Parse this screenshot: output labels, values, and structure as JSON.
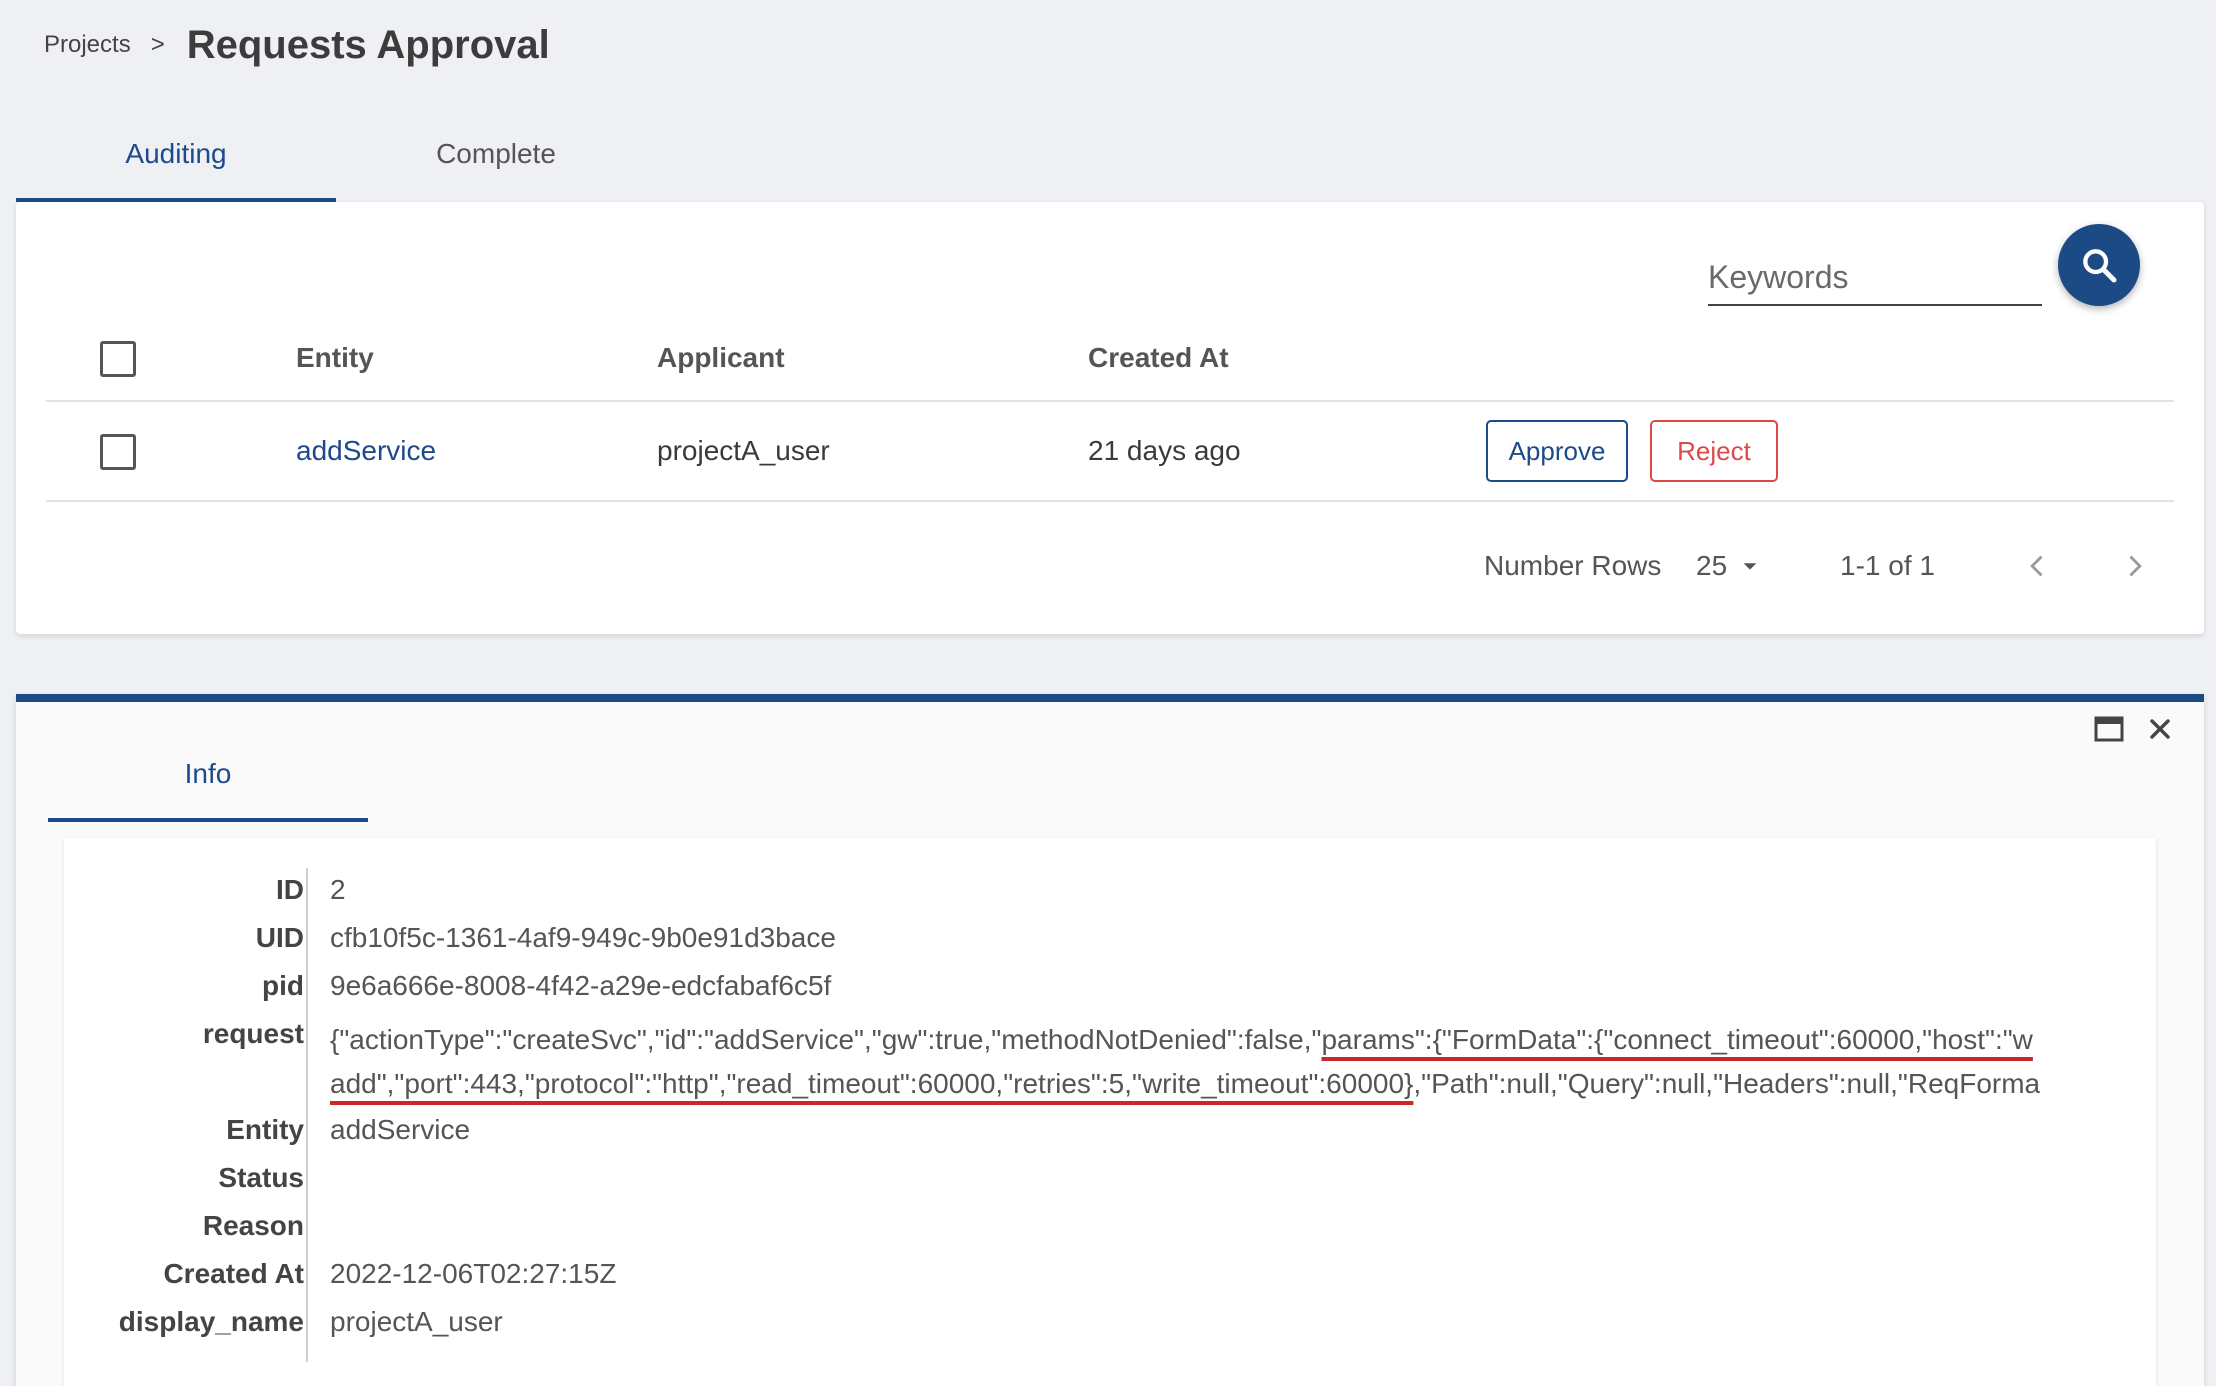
{
  "breadcrumb": {
    "parent": "Projects",
    "separator": ">",
    "title": "Requests Approval"
  },
  "tabs": [
    {
      "label": "Auditing",
      "active": true
    },
    {
      "label": "Complete",
      "active": false
    }
  ],
  "search": {
    "placeholder": "Keywords",
    "value": ""
  },
  "table": {
    "columns": [
      "Entity",
      "Applicant",
      "Created At"
    ],
    "rows": [
      {
        "entity": "addService",
        "applicant": "projectA_user",
        "created_at": "21 days ago",
        "approve_label": "Approve",
        "reject_label": "Reject"
      }
    ]
  },
  "pagination": {
    "rows_label": "Number Rows",
    "rows_per_page": "25",
    "range": "1-1 of 1"
  },
  "detail": {
    "tab": "Info",
    "fields": {
      "id": {
        "label": "ID",
        "value": "2"
      },
      "uid": {
        "label": "UID",
        "value": "cfb10f5c-1361-4af9-949c-9b0e91d3bace"
      },
      "pid": {
        "label": "pid",
        "value": "9e6a666e-8008-4f42-a29e-edcfabaf6c5f"
      },
      "request": {
        "label": "request",
        "line1_pre": "{\"actionType\":\"createSvc\",\"id\":\"addService\",\"gw\":true,\"methodNotDenied\":false,\"",
        "line1_hl": "params\":{\"FormData\":{\"connect_timeout\":60000,\"host\":\"w",
        "line2_hl": "add\",\"port\":443,\"protocol\":\"http\",\"read_timeout\":60000,\"retries\":5,\"write_timeout\":60000}",
        "line2_post": ",\"Path\":null,\"Query\":null,\"Headers\":null,\"ReqForma"
      },
      "entity": {
        "label": "Entity",
        "value": "addService"
      },
      "status": {
        "label": "Status",
        "value": ""
      },
      "reason": {
        "label": "Reason",
        "value": ""
      },
      "created_at": {
        "label": "Created At",
        "value": "2022-12-06T02:27:15Z"
      },
      "display_name": {
        "label": "display_name",
        "value": "projectA_user"
      }
    }
  },
  "colors": {
    "primary": "#1b4a84",
    "link": "#1c4a8a",
    "danger": "#e04848",
    "highlight": "#c8282a",
    "background": "#eef0f4"
  },
  "icons": [
    "search-icon",
    "chevron-down-icon",
    "chevron-left-icon",
    "chevron-right-icon",
    "maximize-icon",
    "close-icon"
  ]
}
